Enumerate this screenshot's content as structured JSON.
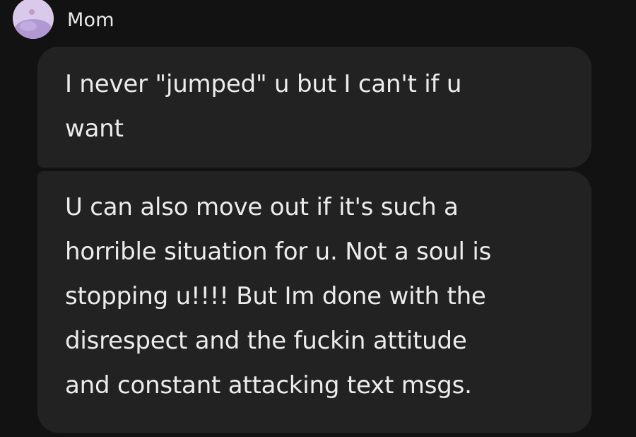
{
  "conversation": {
    "sender_name": "Mom",
    "avatar": {
      "icon": "profile-avatar-icon",
      "colors": [
        "#f2e8f6",
        "#b39ad2"
      ]
    },
    "messages": [
      {
        "text": "I never \"jumped\" u but I can't if u\nwant"
      },
      {
        "text": "U can also move out if it's such a\nhorrible situation for u. Not a soul is\nstopping u!!!! But Im done with the\ndisrespect and the fuckin attitude\nand constant attacking text msgs."
      }
    ]
  },
  "theme": {
    "background": "#121212",
    "bubble_color": "#222222",
    "text_color": "#ececec"
  }
}
